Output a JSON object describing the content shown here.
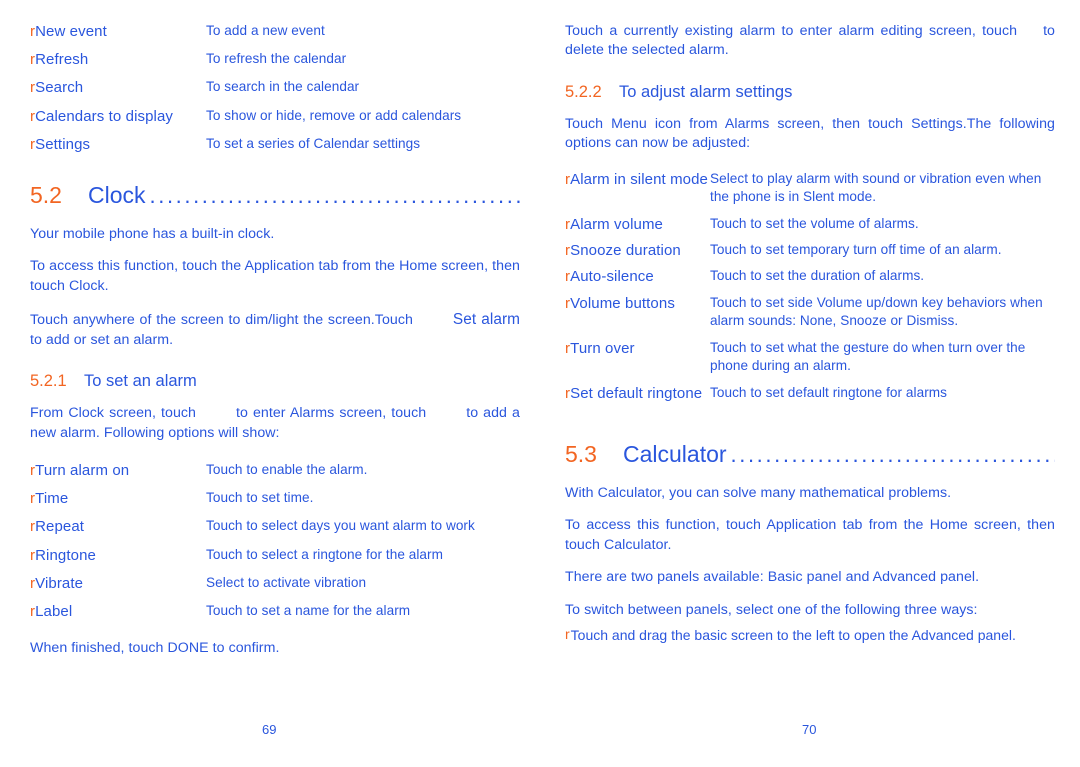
{
  "document": {
    "bullet_glyph": "r",
    "accent_orange": "#f26522",
    "text_blue": "#2a56dd"
  },
  "left_page": {
    "page_number": "69",
    "calendar_menu_options": [
      {
        "term": "New event",
        "desc": "To add a new event"
      },
      {
        "term": "Refresh",
        "desc": "To refresh the calendar"
      },
      {
        "term": "Search",
        "desc": "To search in the calendar"
      },
      {
        "term": "Calendars to display",
        "desc": "To show or hide, remove or add calendars"
      },
      {
        "term": "Settings",
        "desc": "To set a series of Calendar settings"
      }
    ],
    "clock_heading": {
      "number": "5.2",
      "title": "Clock",
      "leader": "................................................................"
    },
    "clock_paragraphs": [
      "Your mobile phone has a built-in clock.",
      "To access this function, touch the Application tab from the Home screen, then touch Clock.",
      "Touch anywhere of the screen to dim/light the screen.Touch",
      "Set alarm to add or set an alarm."
    ],
    "clock_para_3_part1": "Touch anywhere of the screen to dim/light the screen.Touch",
    "clock_para_3_part2": "Set alarm",
    "clock_para_3_part3": " to add or set an alarm.",
    "set_alarm_heading": {
      "number": "5.2.1",
      "title": "To set an alarm"
    },
    "set_alarm_intro_part1": "From Clock screen, touch",
    "set_alarm_intro_part2": "to enter Alarms screen, touch",
    "set_alarm_intro_part3": "to add a new alarm. Following options will show:",
    "alarm_options": [
      {
        "term": "Turn alarm on",
        "desc": "Touch to enable the alarm."
      },
      {
        "term": "Time",
        "desc": "Touch to set time."
      },
      {
        "term": "Repeat",
        "desc": "Touch to select days you want alarm to work"
      },
      {
        "term": "Ringtone",
        "desc": "Touch to select a ringtone for the alarm"
      },
      {
        "term": "Vibrate",
        "desc": "Select to activate vibration"
      },
      {
        "term": "Label",
        "desc": "Touch to set a name for the alarm"
      }
    ],
    "finish_note": "When finished, touch DONE to confirm."
  },
  "right_page": {
    "page_number": "70",
    "edit_alarm_part1": "Touch a currently existing alarm to enter alarm editing screen, touch",
    "edit_alarm_part2": "to delete the selected alarm.",
    "adjust_heading": {
      "number": "5.2.2",
      "title": "To adjust alarm settings"
    },
    "adjust_intro": "Touch Menu icon from Alarms screen, then touch Settings.The following options can now be adjusted:",
    "alarm_settings": [
      {
        "term": "Alarm in silent mode",
        "desc": "Select to play alarm with sound or vibration even when the phone is in Slent mode."
      },
      {
        "term": "Alarm volume",
        "desc": "Touch to set the volume of alarms."
      },
      {
        "term": "Snooze duration",
        "desc": "Touch to set temporary turn off time of an alarm."
      },
      {
        "term": "Auto-silence",
        "desc": "Touch to set the duration of alarms."
      },
      {
        "term": "Volume buttons",
        "desc": "Touch to set side Volume up/down key behaviors when alarm sounds: None, Snooze or Dismiss."
      },
      {
        "term": "Turn over",
        "desc": "Touch to set what the gesture do when turn over the phone during an alarm."
      },
      {
        "term": "Set default ringtone",
        "desc": "Touch to set default ringtone for alarms"
      }
    ],
    "calculator_heading": {
      "number": "5.3",
      "title": "Calculator",
      "leader": "......................................................."
    },
    "calculator_paragraphs": [
      "With Calculator, you can solve many mathematical problems.",
      "To access this function, touch Application tab from the Home screen, then touch Calculator.",
      "There are two panels available: Basic panel and Advanced panel.",
      "To switch between panels, select one of the following three ways:"
    ],
    "calculator_bullet": "Touch and drag the basic screen to the left to open the Advanced panel."
  }
}
